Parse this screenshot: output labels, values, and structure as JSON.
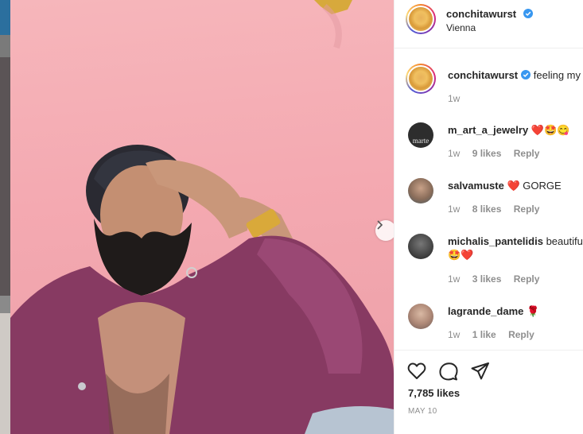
{
  "post": {
    "username": "conchitawurst",
    "location": "Vienna",
    "caption": "feeling my",
    "caption_time": "1w",
    "likes": "7,785 likes",
    "date": "MAY 10"
  },
  "comments": [
    {
      "username": "m_art_a_jewelry",
      "text": "❤️🤩😋",
      "time": "1w",
      "likes": "9 likes",
      "reply": "Reply",
      "avatar_text": "marte"
    },
    {
      "username": "salvamuste",
      "text": "❤️ GORGE",
      "time": "1w",
      "likes": "8 likes",
      "reply": "Reply"
    },
    {
      "username": "michalis_pantelidis",
      "text": "beautifu",
      "text2": "🤩❤️",
      "time": "1w",
      "likes": "3 likes",
      "reply": "Reply"
    },
    {
      "username": "lagrande_dame",
      "text": "🌹",
      "time": "1w",
      "likes": "1 like",
      "reply": "Reply"
    }
  ],
  "icons": {
    "like": "heart-icon",
    "comment": "comment-icon",
    "share": "share-icon",
    "next": "chevron-right-icon",
    "verified": "verified-badge-icon"
  },
  "colors": {
    "verified_blue": "#3897f0",
    "meta_gray": "#8e8e8e",
    "photo_pink": "#f4a9b1",
    "shirt_purple": "#8a3a64"
  }
}
